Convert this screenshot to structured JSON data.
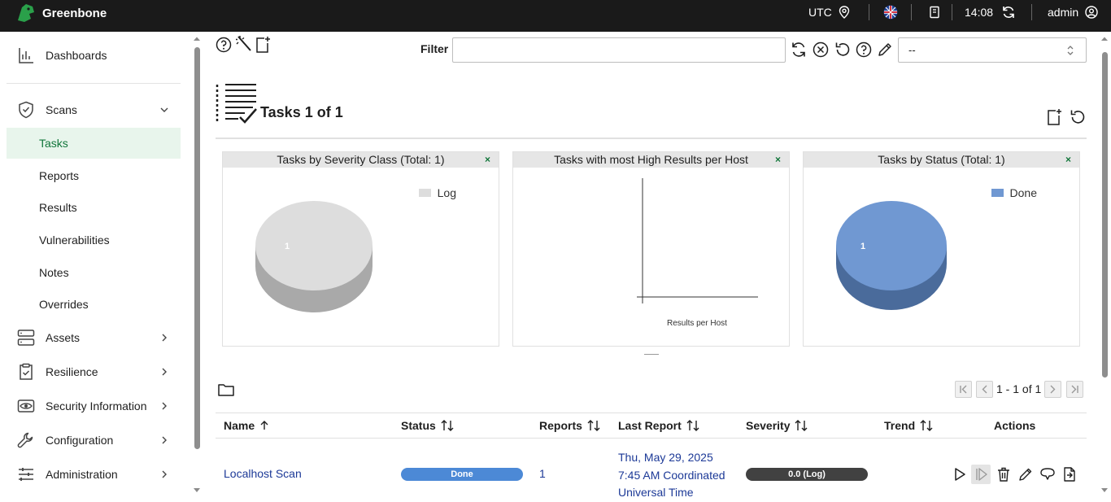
{
  "app": {
    "name": "Greenbone"
  },
  "topbar": {
    "timezone": "UTC",
    "time": "14:08",
    "user": "admin"
  },
  "sidebar": {
    "dashboards": "Dashboards",
    "scans": "Scans",
    "scans_sub": [
      "Tasks",
      "Reports",
      "Results",
      "Vulnerabilities",
      "Notes",
      "Overrides"
    ],
    "assets": "Assets",
    "resilience": "Resilience",
    "security_information": "Security Information",
    "configuration": "Configuration",
    "administration": "Administration"
  },
  "filter": {
    "label": "Filter",
    "value": "",
    "select_value": "--"
  },
  "page": {
    "title": "Tasks 1 of 1"
  },
  "charts": {
    "severity": {
      "title": "Tasks by Severity Class (Total: 1)",
      "close": "×",
      "legend": "Log",
      "legend_color": "#dddddd",
      "slice_label": "1"
    },
    "high_results": {
      "title": "Tasks with most High Results per Host",
      "close": "×",
      "xlabel": "Results per Host"
    },
    "status": {
      "title": "Tasks by Status (Total: 1)",
      "close": "×",
      "legend": "Done",
      "legend_color": "#7098d2",
      "slice_label": "1"
    }
  },
  "chart_data": [
    {
      "type": "pie",
      "title": "Tasks by Severity Class (Total: 1)",
      "categories": [
        "Log"
      ],
      "values": [
        1
      ],
      "colors": [
        "#dddddd"
      ]
    },
    {
      "type": "scatter",
      "title": "Tasks with most High Results per Host",
      "xlabel": "Results per Host",
      "ylabel": "",
      "x": [],
      "y": []
    },
    {
      "type": "pie",
      "title": "Tasks by Status (Total: 1)",
      "categories": [
        "Done"
      ],
      "values": [
        1
      ],
      "colors": [
        "#7098d2"
      ]
    }
  ],
  "pagination": {
    "text": "1 - 1 of 1"
  },
  "table": {
    "headers": {
      "name": "Name",
      "status": "Status",
      "reports": "Reports",
      "last_report": "Last Report",
      "severity": "Severity",
      "trend": "Trend",
      "actions": "Actions"
    },
    "rows": [
      {
        "name": "Localhost Scan",
        "status": "Done",
        "status_progress": 1.0,
        "reports": "1",
        "last_report_line1": "Thu, May 29, 2025",
        "last_report_line2": "7:45 AM Coordinated",
        "last_report_line3": "Universal Time",
        "severity": "0.0 (Log)",
        "severity_value": 0.0
      }
    ]
  },
  "colors": {
    "brand_green": "#11763a",
    "link_blue": "#1c3997",
    "done_blue": "#4c89d6",
    "severity_dark": "#414141"
  }
}
